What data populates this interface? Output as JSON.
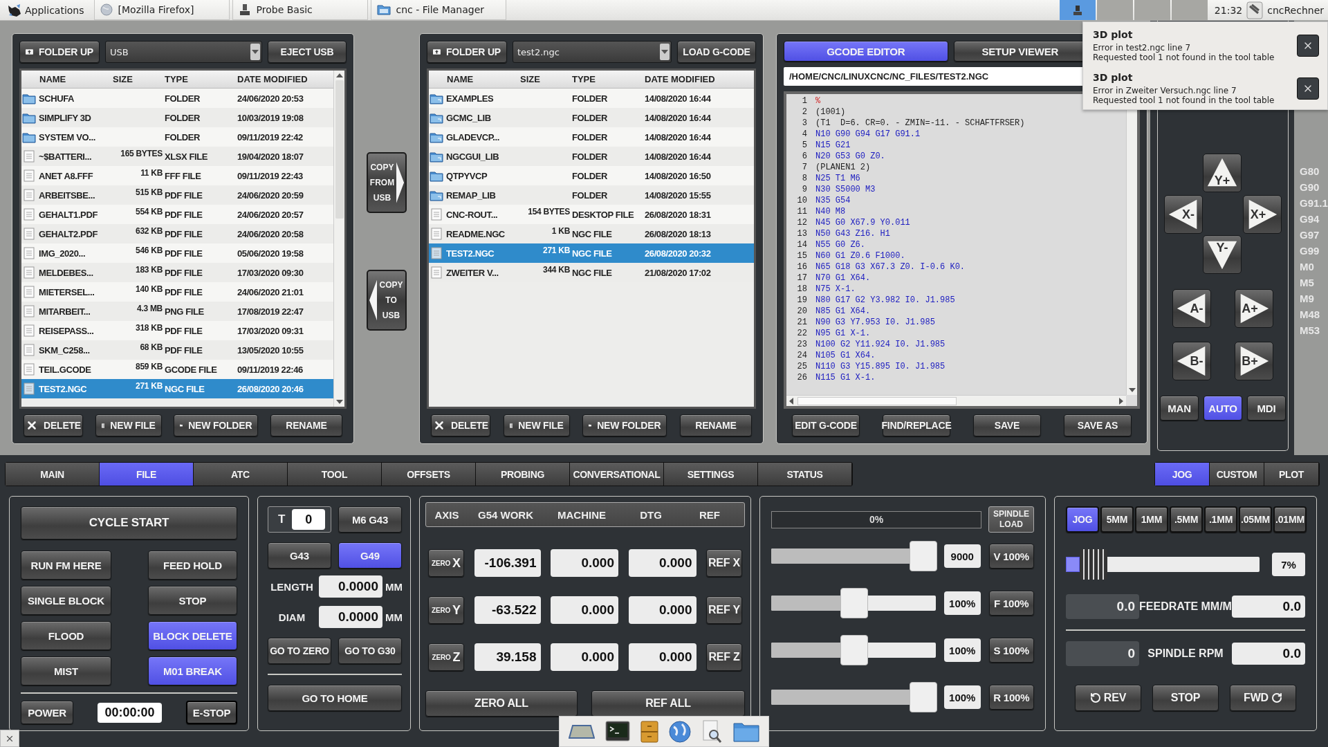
{
  "taskbar": {
    "apps_menu": "Applications",
    "tasks": [
      {
        "label": "[Mozilla Firefox]"
      },
      {
        "label": "Probe Basic"
      },
      {
        "label": "cnc - File Manager"
      }
    ],
    "workspaces": [
      {
        "selected": true
      },
      {
        "selected": false
      },
      {
        "selected": false
      },
      {
        "selected": false
      }
    ],
    "clock": "21:32",
    "user": "cncRechner"
  },
  "notifications": [
    {
      "title": "3D plot",
      "message": "Error in test2.ngc line 7",
      "detail": "Requested tool 1 not found in the tool table"
    },
    {
      "title": "3D plot",
      "message": "Error in Zweiter Versuch.ngc line 7",
      "detail": "Requested tool 1 not found in the tool table"
    }
  ],
  "usb_browser": {
    "folder_up": "FOLDER UP",
    "path": "USB",
    "action": "EJECT USB",
    "columns": [
      "NAME",
      "SIZE",
      "TYPE",
      "DATE MODIFIED"
    ],
    "rows": [
      {
        "kind": "folder",
        "name": "SCHUFA",
        "type": "FOLDER",
        "date": "24/06/2020 20:53",
        "selected": false
      },
      {
        "kind": "folder",
        "name": "SIMPLIFY 3D",
        "type": "FOLDER",
        "date": "10/03/2019 19:08",
        "selected": false
      },
      {
        "kind": "folder",
        "name": "SYSTEM VO...",
        "type": "FOLDER",
        "date": "09/11/2019 22:42",
        "selected": false
      },
      {
        "kind": "file",
        "name": "~$BATTERI...",
        "size": "165 BYTES",
        "type": "XLSX FILE",
        "date": "19/04/2020 18:07",
        "selected": false
      },
      {
        "kind": "file",
        "name": "ANET A8.FFF",
        "size": "11 KB",
        "type": "FFF FILE",
        "date": "09/11/2019 22:43",
        "selected": false
      },
      {
        "kind": "file",
        "name": "ARBEITSBE...",
        "size": "515 KB",
        "type": "PDF FILE",
        "date": "24/06/2020 20:59",
        "selected": false
      },
      {
        "kind": "file",
        "name": "GEHALT1.PDF",
        "size": "554 KB",
        "type": "PDF FILE",
        "date": "24/06/2020 20:57",
        "selected": false
      },
      {
        "kind": "file",
        "name": "GEHALT2.PDF",
        "size": "632 KB",
        "type": "PDF FILE",
        "date": "24/06/2020 20:58",
        "selected": false
      },
      {
        "kind": "file",
        "name": "IMG_2020...",
        "size": "546 KB",
        "type": "PDF FILE",
        "date": "05/06/2020 19:58",
        "selected": false
      },
      {
        "kind": "file",
        "name": "MELDEBES...",
        "size": "183 KB",
        "type": "PDF FILE",
        "date": "17/03/2020 09:30",
        "selected": false
      },
      {
        "kind": "file",
        "name": "MIETERSEL...",
        "size": "140 KB",
        "type": "PDF FILE",
        "date": "24/06/2020 21:01",
        "selected": false
      },
      {
        "kind": "file",
        "name": "MITARBEIT...",
        "size": "4.3 MB",
        "type": "PNG FILE",
        "date": "17/08/2019 22:47",
        "selected": false
      },
      {
        "kind": "file",
        "name": "REISEPASS...",
        "size": "318 KB",
        "type": "PDF FILE",
        "date": "17/03/2020 09:31",
        "selected": false
      },
      {
        "kind": "file",
        "name": "SKM_C258...",
        "size": "68 KB",
        "type": "PDF FILE",
        "date": "13/05/2020 10:55",
        "selected": false
      },
      {
        "kind": "file",
        "name": "TEIL.GCODE",
        "size": "859 KB",
        "type": "GCODE FILE",
        "date": "09/11/2019 22:46",
        "selected": false
      },
      {
        "kind": "file",
        "name": "TEST2.NGC",
        "size": "271 KB",
        "type": "NGC FILE",
        "date": "26/08/2020 20:46",
        "selected": true
      }
    ],
    "buttons": [
      "DELETE",
      "NEW FILE",
      "NEW FOLDER",
      "RENAME"
    ]
  },
  "copy_buttons": [
    {
      "label": "COPY FROM USB",
      "kind": "right"
    },
    {
      "label": "COPY TO USB",
      "kind": "left"
    }
  ],
  "local_browser": {
    "folder_up": "FOLDER UP",
    "path": "test2.ngc",
    "action": "LOAD G-CODE",
    "columns": [
      "NAME",
      "SIZE",
      "TYPE",
      "DATE MODIFIED"
    ],
    "rows": [
      {
        "kind": "linked_folder",
        "name": "EXAMPLES",
        "type": "FOLDER",
        "date": "14/08/2020 16:44",
        "selected": false
      },
      {
        "kind": "linked_folder",
        "name": "GCMC_LIB",
        "type": "FOLDER",
        "date": "14/08/2020 16:44",
        "selected": false
      },
      {
        "kind": "linked_folder",
        "name": "GLADEVCP...",
        "type": "FOLDER",
        "date": "14/08/2020 16:44",
        "selected": false
      },
      {
        "kind": "linked_folder",
        "name": "NGCGUI_LIB",
        "type": "FOLDER",
        "date": "14/08/2020 16:44",
        "selected": false
      },
      {
        "kind": "folder",
        "name": "QTPYVCP",
        "type": "FOLDER",
        "date": "14/08/2020 16:50",
        "selected": false
      },
      {
        "kind": "linked_folder",
        "name": "REMAP_LIB",
        "type": "FOLDER",
        "date": "14/08/2020 15:55",
        "selected": false
      },
      {
        "kind": "file",
        "name": "CNC-ROUT...",
        "size": "154 BYTES",
        "type": "DESKTOP FILE",
        "date": "26/08/2020 18:31",
        "selected": false
      },
      {
        "kind": "file",
        "name": "README.NGC",
        "size": "1 KB",
        "type": "NGC FILE",
        "date": "26/08/2020 18:13",
        "selected": false
      },
      {
        "kind": "file",
        "name": "TEST2.NGC",
        "size": "271 KB",
        "type": "NGC FILE",
        "date": "26/08/2020 20:32",
        "selected": true
      },
      {
        "kind": "file",
        "name": "ZWEITER V...",
        "size": "344 KB",
        "type": "NGC FILE",
        "date": "21/08/2020 17:02",
        "selected": false
      }
    ],
    "buttons": [
      "DELETE",
      "NEW FILE",
      "NEW FOLDER",
      "RENAME"
    ]
  },
  "gcode_editor": {
    "tabs": [
      {
        "label": "GCODE EDITOR",
        "selected": true
      },
      {
        "label": "SETUP VIEWER",
        "selected": false
      }
    ],
    "file_path": "/HOME/CNC/LINUXCNC/NC_FILES/TEST2.NGC",
    "lines": [
      {
        "n": "1",
        "text": "%",
        "kind": "mark"
      },
      {
        "n": "2",
        "text": "(1001)",
        "kind": "comment"
      },
      {
        "n": "3",
        "text": "(T1  D=6. CR=0. - ZMIN=-11. - SCHAFTFRSER)",
        "kind": "comment"
      },
      {
        "n": "4",
        "text": "N10 G90 G94 G17 G91.1",
        "kind": "code"
      },
      {
        "n": "5",
        "text": "N15 G21",
        "kind": "code"
      },
      {
        "n": "6",
        "text": "N20 G53 G0 Z0.",
        "kind": "code"
      },
      {
        "n": "7",
        "text": "(PLANEN1 2)",
        "kind": "comment"
      },
      {
        "n": "8",
        "text": "N25 T1 M6",
        "kind": "code"
      },
      {
        "n": "9",
        "text": "N30 S5000 M3",
        "kind": "code"
      },
      {
        "n": "10",
        "text": "N35 G54",
        "kind": "code"
      },
      {
        "n": "11",
        "text": "N40 M8",
        "kind": "code"
      },
      {
        "n": "12",
        "text": "N45 G0 X67.9 Y0.011",
        "kind": "code"
      },
      {
        "n": "13",
        "text": "N50 G43 Z16. H1",
        "kind": "code"
      },
      {
        "n": "14",
        "text": "N55 G0 Z6.",
        "kind": "code"
      },
      {
        "n": "15",
        "text": "N60 G1 Z0.6 F1000.",
        "kind": "code"
      },
      {
        "n": "16",
        "text": "N65 G18 G3 X67.3 Z0. I-0.6 K0.",
        "kind": "code"
      },
      {
        "n": "17",
        "text": "N70 G1 X64.",
        "kind": "code"
      },
      {
        "n": "18",
        "text": "N75 X-1.",
        "kind": "code"
      },
      {
        "n": "19",
        "text": "N80 G17 G2 Y3.982 I0. J1.985",
        "kind": "code"
      },
      {
        "n": "20",
        "text": "N85 G1 X64.",
        "kind": "code"
      },
      {
        "n": "21",
        "text": "N90 G3 Y7.953 I0. J1.985",
        "kind": "code"
      },
      {
        "n": "22",
        "text": "N95 G1 X-1.",
        "kind": "code"
      },
      {
        "n": "23",
        "text": "N100 G2 Y11.924 I0. J1.985",
        "kind": "code"
      },
      {
        "n": "24",
        "text": "N105 G1 X64.",
        "kind": "code"
      },
      {
        "n": "25",
        "text": "N110 G3 Y15.895 I0. J1.985",
        "kind": "code"
      },
      {
        "n": "26",
        "text": "N115 G1 X-1.",
        "kind": "code"
      }
    ],
    "buttons": [
      "EDIT G-CODE",
      "FIND/REPLACE",
      "SAVE",
      "SAVE AS"
    ]
  },
  "jog_pad": {
    "xy": [
      {
        "label": "Y+",
        "kind": "up"
      },
      {
        "label": "X-",
        "kind": "left"
      },
      {
        "label": "X+",
        "kind": "right"
      },
      {
        "label": "Y-",
        "kind": "down"
      }
    ],
    "ab": [
      {
        "label": "A-",
        "kind": "left"
      },
      {
        "label": "A+",
        "kind": "right"
      },
      {
        "label": "B-",
        "kind": "left"
      },
      {
        "label": "B+",
        "kind": "right"
      }
    ],
    "modes": [
      {
        "label": "MAN",
        "selected": false
      },
      {
        "label": "AUTO",
        "selected": true
      },
      {
        "label": "MDI",
        "selected": false
      }
    ]
  },
  "active_codes": [
    "G80",
    "G90",
    "G91.1",
    "G94",
    "G97",
    "G99",
    "M0",
    "M5",
    "M9",
    "M48",
    "M53"
  ],
  "main_tabs": [
    {
      "label": "MAIN",
      "selected": false
    },
    {
      "label": "FILE",
      "selected": true
    },
    {
      "label": "ATC",
      "selected": false
    },
    {
      "label": "TOOL",
      "selected": false
    },
    {
      "label": "OFFSETS",
      "selected": false
    },
    {
      "label": "PROBING",
      "selected": false
    },
    {
      "label": "CONVERSATIONAL",
      "selected": false
    },
    {
      "label": "SETTINGS",
      "selected": false
    },
    {
      "label": "STATUS",
      "selected": false
    }
  ],
  "side_tabs": [
    {
      "label": "JOG",
      "selected": true
    },
    {
      "label": "CUSTOM",
      "selected": false
    },
    {
      "label": "PLOT",
      "selected": false
    }
  ],
  "program_panel": {
    "cycle_start": "CYCLE START",
    "toggles": [
      {
        "label": "RUN FM HERE",
        "on": false
      },
      {
        "label": "FEED HOLD",
        "on": false
      },
      {
        "label": "SINGLE BLOCK",
        "on": false
      },
      {
        "label": "STOP",
        "on": false
      },
      {
        "label": "FLOOD",
        "on": false
      },
      {
        "label": "BLOCK DELETE",
        "on": true
      },
      {
        "label": "MIST",
        "on": false
      },
      {
        "label": "M01 BREAK",
        "on": true
      }
    ],
    "power": "POWER",
    "timer": "00:00:00",
    "estop": "E-STOP"
  },
  "tool_panel": {
    "tool_label": "T",
    "tool_number": "0",
    "change": "M6 G43",
    "comp": [
      {
        "label": "G43",
        "selected": false
      },
      {
        "label": "G49",
        "selected": true
      }
    ],
    "fields": [
      {
        "label": "LENGTH",
        "value": "0.0000",
        "unit": "MM"
      },
      {
        "label": "DIAM",
        "value": "0.0000",
        "unit": "MM"
      }
    ],
    "go_buttons": [
      "GO TO ZERO",
      "GO TO G30"
    ],
    "home": "GO TO HOME"
  },
  "dro": {
    "columns": [
      "AXIS",
      "G54 WORK",
      "MACHINE",
      "DTG",
      "REF"
    ],
    "axes": [
      {
        "zero": "ZERO",
        "axis": "X",
        "work": "-106.391",
        "machine": "0.000",
        "dtg": "0.000",
        "ref": "REF X"
      },
      {
        "zero": "ZERO",
        "axis": "Y",
        "work": "-63.522",
        "machine": "0.000",
        "dtg": "0.000",
        "ref": "REF Y"
      },
      {
        "zero": "ZERO",
        "axis": "Z",
        "work": "39.158",
        "machine": "0.000",
        "dtg": "0.000",
        "ref": "REF Z"
      }
    ],
    "zero_all": "ZERO ALL",
    "ref_all": "REF ALL"
  },
  "override_panel": {
    "spindle_load": {
      "level": 0,
      "reading": "0%"
    },
    "load_button": "SPINDLE LOAD",
    "sliders": [
      {
        "level": 1,
        "value": "9000",
        "button": "V 100%"
      },
      {
        "level": 0.5,
        "value": "100%",
        "button": "F 100%"
      },
      {
        "level": 0.5,
        "value": "100%",
        "button": "S 100%"
      },
      {
        "level": 1,
        "value": "100%",
        "button": "R 100%"
      }
    ]
  },
  "jog_panel": {
    "increments": [
      {
        "label": "JOG",
        "selected": true
      },
      {
        "label": "5MM",
        "selected": false
      },
      {
        "label": "1MM",
        "selected": false
      },
      {
        "label": ".5MM",
        "selected": false
      },
      {
        "label": ".1MM",
        "selected": false
      },
      {
        "label": ".05MM",
        "selected": false
      },
      {
        "label": ".01MM",
        "selected": false
      }
    ],
    "speed": {
      "level": 0.07,
      "reading": "7%"
    },
    "readouts": [
      {
        "label": "FEEDRATE MM/M",
        "actual": "0.0",
        "commanded": "0.0"
      },
      {
        "label": "SPINDLE RPM",
        "actual": "0",
        "commanded": "0.0"
      }
    ],
    "spindle_buttons": [
      {
        "label": "REV",
        "kind": "rev"
      },
      {
        "label": "STOP",
        "kind": "stop"
      },
      {
        "label": "FWD",
        "kind": "fwd"
      }
    ]
  }
}
